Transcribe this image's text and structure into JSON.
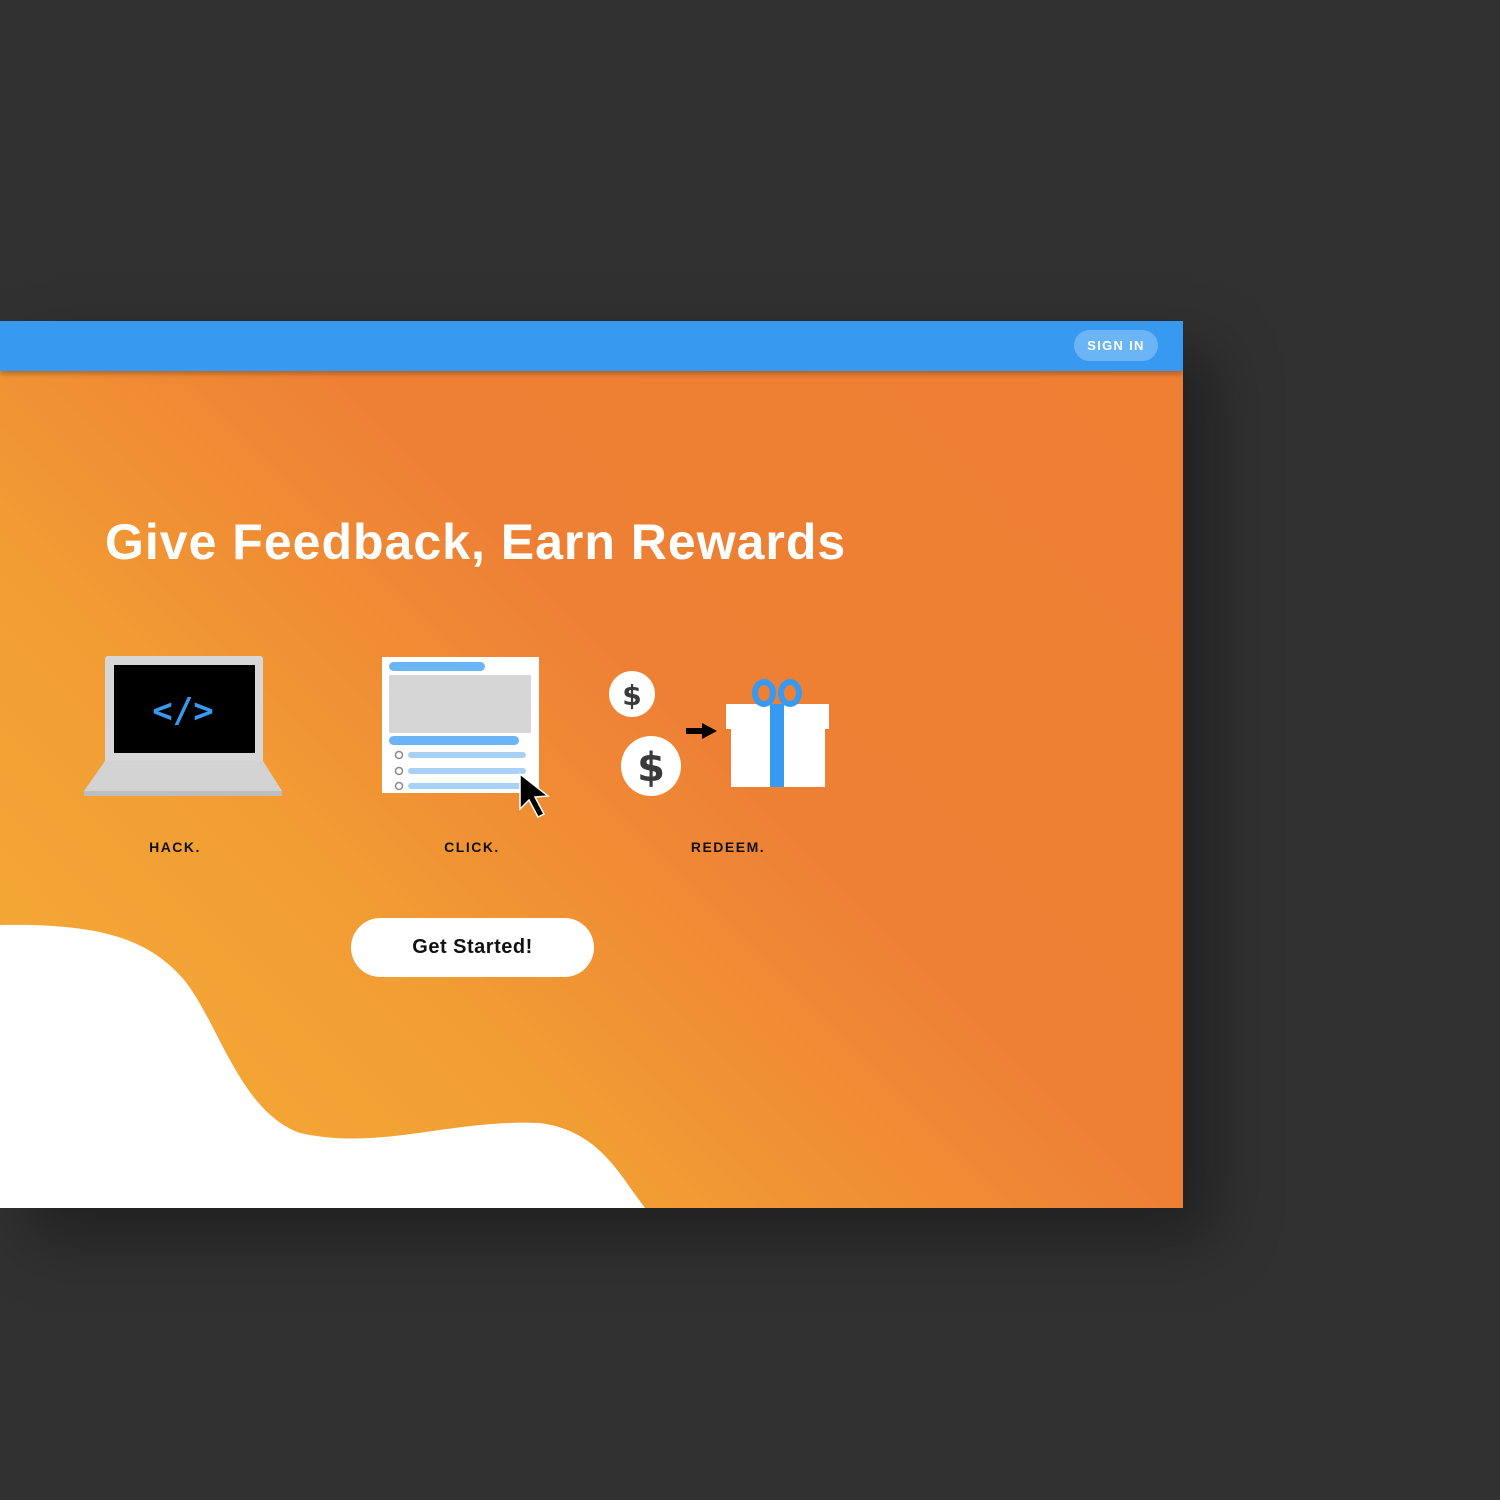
{
  "header": {
    "sign_in_label": "SIGN IN"
  },
  "hero": {
    "headline": "Give Feedback, Earn Rewards",
    "steps": [
      {
        "label": "HACK.",
        "icon": "laptop-code-icon",
        "code_glyph": "</>"
      },
      {
        "label": "CLICK.",
        "icon": "survey-form-cursor-icon"
      },
      {
        "label": "REDEEM.",
        "icon": "coins-to-gift-icon",
        "coin_symbol": "$"
      }
    ],
    "cta_label": "Get Started!"
  },
  "colors": {
    "topbar": "#3899f1",
    "sign_in_pill": "#6bb4f5",
    "gradient_start": "#f5ae36",
    "gradient_end": "#ee7f33",
    "accent_blue": "#3899f1",
    "background": "#313131"
  }
}
